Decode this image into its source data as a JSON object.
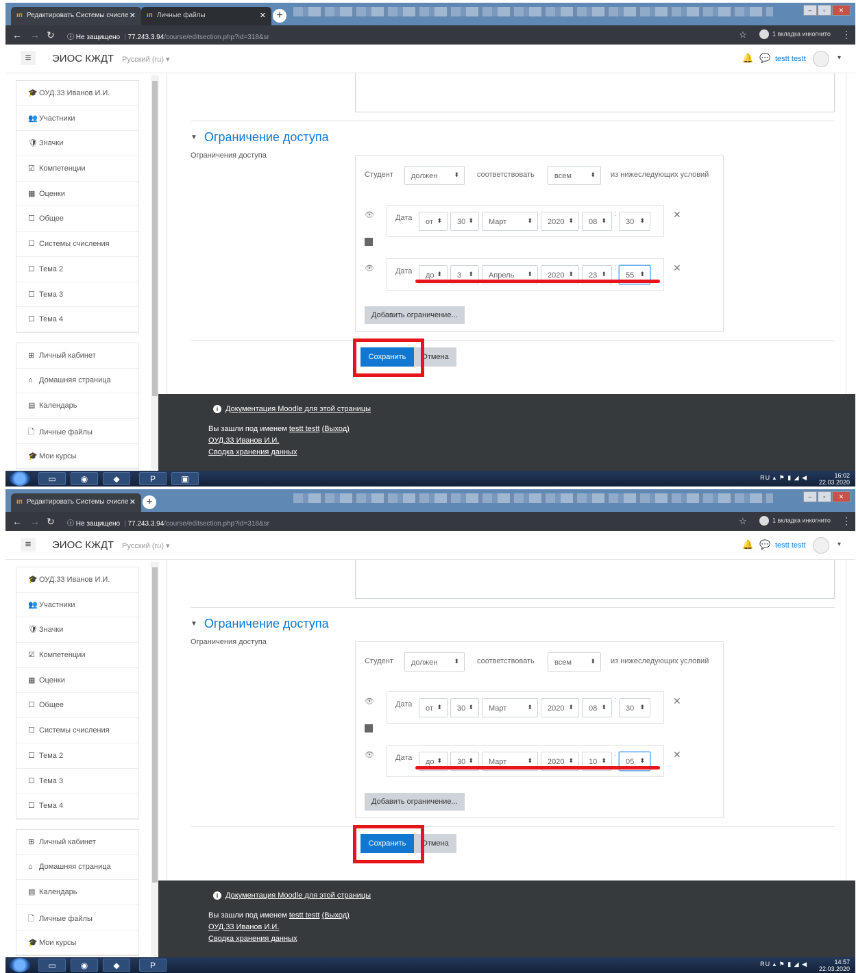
{
  "screenshots": [
    {
      "tabs": [
        {
          "label": "Редактировать Системы счисле",
          "close": "✕",
          "favicon": "ıп"
        },
        {
          "label": "Личные файлы",
          "close": "✕",
          "favicon": "ıп"
        }
      ],
      "new_tab": "+",
      "address": {
        "not_secure": "ⓘ Не защищено",
        "host": "77.243.3.94",
        "path": "/course/editsection.php?id=318&sr"
      },
      "incognito": "1 вкладка инкогнито",
      "navbar": {
        "brand": "ЭИОС КЖДТ",
        "lang": "Русский (ru) ▾",
        "user": "testt testt"
      },
      "sidebar": {
        "items": [
          {
            "icon": "🎓",
            "icon_name": "graduation-cap-icon",
            "label": "ОУД.33 Иванов И.И."
          },
          {
            "icon": "👥",
            "icon_name": "users-icon",
            "label": "Участники"
          },
          {
            "icon": "🛡",
            "icon_name": "shield-icon",
            "label": "Значки"
          },
          {
            "icon": "☑",
            "icon_name": "checkbox-icon",
            "label": "Компетенции"
          },
          {
            "icon": "▦",
            "icon_name": "table-icon",
            "label": "Оценки"
          },
          {
            "icon": "☐",
            "icon_name": "folder-icon",
            "label": "Общее"
          },
          {
            "icon": "☐",
            "icon_name": "folder-icon",
            "label": "Системы счисления"
          },
          {
            "icon": "☐",
            "icon_name": "folder-icon",
            "label": "Тема 2"
          },
          {
            "icon": "☐",
            "icon_name": "folder-icon",
            "label": "Тема 3"
          },
          {
            "icon": "☐",
            "icon_name": "folder-icon",
            "label": "Тема 4"
          }
        ],
        "items2": [
          {
            "icon": "⊞",
            "icon_name": "dashboard-icon",
            "label": "Личный кабинет"
          },
          {
            "icon": "⌂",
            "icon_name": "home-icon",
            "label": "Домашняя страница"
          },
          {
            "icon": "▤",
            "icon_name": "calendar-icon",
            "label": "Календарь"
          },
          {
            "icon": "🗋",
            "icon_name": "file-icon",
            "label": "Личные файлы"
          },
          {
            "icon": "🎓",
            "icon_name": "graduation-cap-icon",
            "label": "Мои курсы"
          }
        ]
      },
      "section": {
        "title": "Ограничение доступа",
        "label": "Ограничения доступа"
      },
      "availability": {
        "lead": "Студент",
        "must": "должен",
        "match": "соответствовать",
        "all": "всем",
        "tail": "из нижеследующих условий",
        "cond1": {
          "label": "Дата",
          "direction": "от",
          "day": "30",
          "month": "Март",
          "year": "2020",
          "hour": "08",
          "minute": "30"
        },
        "cond2": {
          "label": "Дата",
          "direction": "до",
          "day": "3",
          "month": "Апрель",
          "year": "2020",
          "hour": "23",
          "minute": "55"
        },
        "add_restriction": "Добавить ограничение..."
      },
      "buttons": {
        "save": "Сохранить",
        "cancel": "Отмена"
      },
      "footer": {
        "doc_link": "Документация Moodle для этой страницы",
        "login_prefix": "Вы зашли под именем",
        "login_user": "testt testt",
        "logout": "(Выход)",
        "course": "ОУД.33 Иванов И.И.",
        "data_summary": "Сводка хранения данных"
      },
      "taskbar": {
        "lang": "RU",
        "time": "16:02",
        "date": "22.03.2020"
      }
    },
    {
      "tabs": [
        {
          "label": "Редактировать Системы счисле",
          "close": "✕",
          "favicon": "ıп"
        }
      ],
      "new_tab": "+",
      "address": {
        "not_secure": "ⓘ Не защищено",
        "host": "77.243.3.94",
        "path": "/course/editsection.php?id=318&sr"
      },
      "incognito": "1 вкладка инкогнито",
      "navbar": {
        "brand": "ЭИОС КЖДТ",
        "lang": "Русский (ru) ▾",
        "user": "testt testt"
      },
      "sidebar": {
        "items": [
          {
            "icon": "🎓",
            "icon_name": "graduation-cap-icon",
            "label": "ОУД.33 Иванов И.И."
          },
          {
            "icon": "👥",
            "icon_name": "users-icon",
            "label": "Участники"
          },
          {
            "icon": "🛡",
            "icon_name": "shield-icon",
            "label": "Значки"
          },
          {
            "icon": "☑",
            "icon_name": "checkbox-icon",
            "label": "Компетенции"
          },
          {
            "icon": "▦",
            "icon_name": "table-icon",
            "label": "Оценки"
          },
          {
            "icon": "☐",
            "icon_name": "folder-icon",
            "label": "Общее"
          },
          {
            "icon": "☐",
            "icon_name": "folder-icon",
            "label": "Системы счисления"
          },
          {
            "icon": "☐",
            "icon_name": "folder-icon",
            "label": "Тема 2"
          },
          {
            "icon": "☐",
            "icon_name": "folder-icon",
            "label": "Тема 3"
          },
          {
            "icon": "☐",
            "icon_name": "folder-icon",
            "label": "Тема 4"
          }
        ],
        "items2": [
          {
            "icon": "⊞",
            "icon_name": "dashboard-icon",
            "label": "Личный кабинет"
          },
          {
            "icon": "⌂",
            "icon_name": "home-icon",
            "label": "Домашняя страница"
          },
          {
            "icon": "▤",
            "icon_name": "calendar-icon",
            "label": "Календарь"
          },
          {
            "icon": "🗋",
            "icon_name": "file-icon",
            "label": "Личные файлы"
          },
          {
            "icon": "🎓",
            "icon_name": "graduation-cap-icon",
            "label": "Мои курсы"
          }
        ]
      },
      "section": {
        "title": "Ограничение доступа",
        "label": "Ограничения доступа"
      },
      "availability": {
        "lead": "Студент",
        "must": "должен",
        "match": "соответствовать",
        "all": "всем",
        "tail": "из нижеследующих условий",
        "cond1": {
          "label": "Дата",
          "direction": "от",
          "day": "30",
          "month": "Март",
          "year": "2020",
          "hour": "08",
          "minute": "30"
        },
        "cond2": {
          "label": "Дата",
          "direction": "до",
          "day": "30",
          "month": "Март",
          "year": "2020",
          "hour": "10",
          "minute": "05"
        },
        "add_restriction": "Добавить ограничение..."
      },
      "buttons": {
        "save": "Сохранить",
        "cancel": "Отмена"
      },
      "footer": {
        "doc_link": "Документация Moodle для этой страницы",
        "login_prefix": "Вы зашли под именем",
        "login_user": "testt testt",
        "logout": "(Выход)",
        "course": "ОУД.33 Иванов И.И.",
        "data_summary": "Сводка хранения данных"
      },
      "taskbar": {
        "lang": "RU",
        "time": "14:57",
        "date": "22.03.2020"
      }
    }
  ],
  "colors": {
    "accent": "#1177d1",
    "highlight": "#e8141c",
    "footer_bg": "#373a3c",
    "button_grey": "#ced4da"
  }
}
